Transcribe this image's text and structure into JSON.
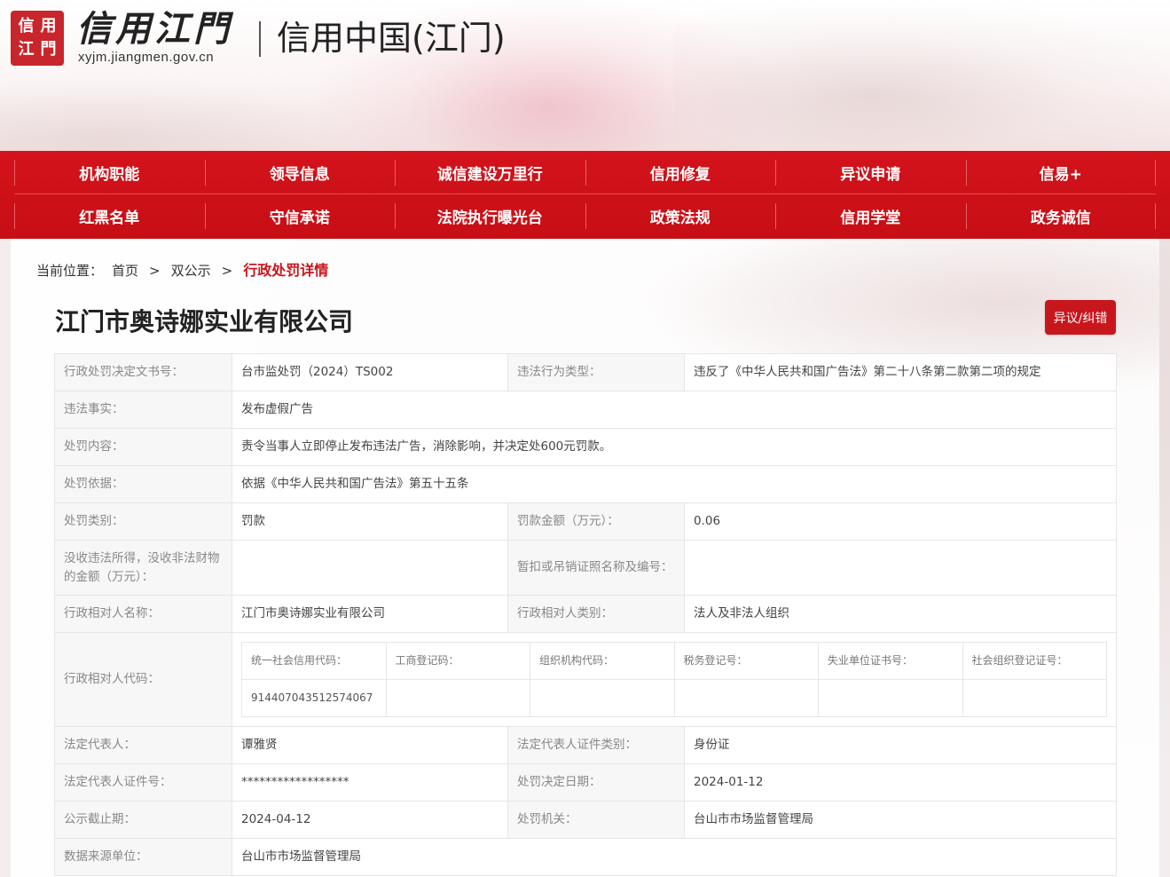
{
  "header": {
    "seal_chars": [
      "信",
      "用",
      "江",
      "門"
    ],
    "logo_text": "信用江門",
    "logo_url": "xyjm.jiangmen.gov.cn",
    "site_title": "信用中国(江门)"
  },
  "nav": {
    "row1": [
      "机构职能",
      "领导信息",
      "诚信建设万里行",
      "信用修复",
      "异议申请",
      "信易+"
    ],
    "row2": [
      "红黑名单",
      "守信承诺",
      "法院执行曝光台",
      "政策法规",
      "信用学堂",
      "政务诚信"
    ]
  },
  "breadcrumb": {
    "label": "当前位置：",
    "home": "首页",
    "sep": ">",
    "section": "双公示",
    "current": "行政处罚详情"
  },
  "company_name": "江门市奥诗娜实业有限公司",
  "objection_button": "异议/纠错",
  "details": {
    "doc_no_label": "行政处罚决定文书号：",
    "doc_no": "台市监处罚（2024）TS002",
    "violation_type_label": "违法行为类型：",
    "violation_type": "违反了《中华人民共和国广告法》第二十八条第二款第二项的规定",
    "facts_label": "违法事实：",
    "facts": "发布虚假广告",
    "content_label": "处罚内容：",
    "content": "责令当事人立即停止发布违法广告，消除影响，并决定处600元罚款。",
    "basis_label": "处罚依据：",
    "basis": "依据《中华人民共和国广告法》第五十五条",
    "category_label": "处罚类别：",
    "category": "罚款",
    "fine_label": "罚款金额（万元）：",
    "fine": "0.06",
    "confiscation_label": "没收违法所得，没收非法财物的金额（万元）：",
    "confiscation": "",
    "license_label": "暂扣或吊销证照名称及编号：",
    "license": "",
    "party_name_label": "行政相对人名称：",
    "party_name": "江门市奥诗娜实业有限公司",
    "party_type_label": "行政相对人类别：",
    "party_type": "法人及非法人组织",
    "party_code_label": "行政相对人代码：",
    "codes": {
      "headers": [
        "统一社会信用代码：",
        "工商登记码：",
        "组织机构代码：",
        "税务登记号：",
        "失业单位证书号：",
        "社会组织登记证号："
      ],
      "values": [
        "914407043512574067",
        "",
        "",
        "",
        "",
        ""
      ]
    },
    "legal_rep_label": "法定代表人：",
    "legal_rep": "谭雅贤",
    "legal_rep_id_type_label": "法定代表人证件类别：",
    "legal_rep_id_type": "身份证",
    "legal_rep_id_no_label": "法定代表人证件号：",
    "legal_rep_id_no": "******************",
    "decision_date_label": "处罚决定日期：",
    "decision_date": "2024-01-12",
    "publish_end_label": "公示截止期：",
    "publish_end": "2024-04-12",
    "authority_label": "处罚机关：",
    "authority": "台山市市场监督管理局",
    "source_label": "数据来源单位：",
    "source": "台山市市场监督管理局"
  }
}
